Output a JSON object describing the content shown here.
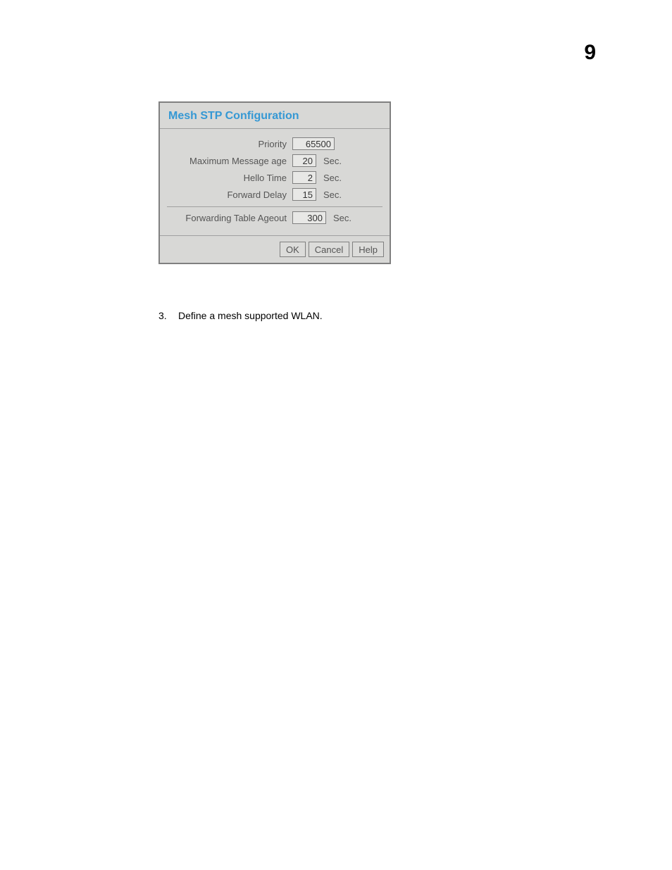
{
  "page": {
    "number": "9"
  },
  "dialog": {
    "title": "Mesh STP Configuration",
    "fields": {
      "priority": {
        "label": "Priority",
        "value": "65500"
      },
      "max_msg_age": {
        "label": "Maximum Message age",
        "value": "20",
        "unit": "Sec."
      },
      "hello_time": {
        "label": "Hello Time",
        "value": "2",
        "unit": "Sec."
      },
      "forward_delay": {
        "label": "Forward Delay",
        "value": "15",
        "unit": "Sec."
      },
      "fwd_table_ageout": {
        "label": "Forwarding Table Ageout",
        "value": "300",
        "unit": "Sec."
      }
    },
    "buttons": {
      "ok": "OK",
      "cancel": "Cancel",
      "help": "Help"
    }
  },
  "instruction": {
    "number": "3.",
    "text": "Define a mesh supported WLAN."
  }
}
